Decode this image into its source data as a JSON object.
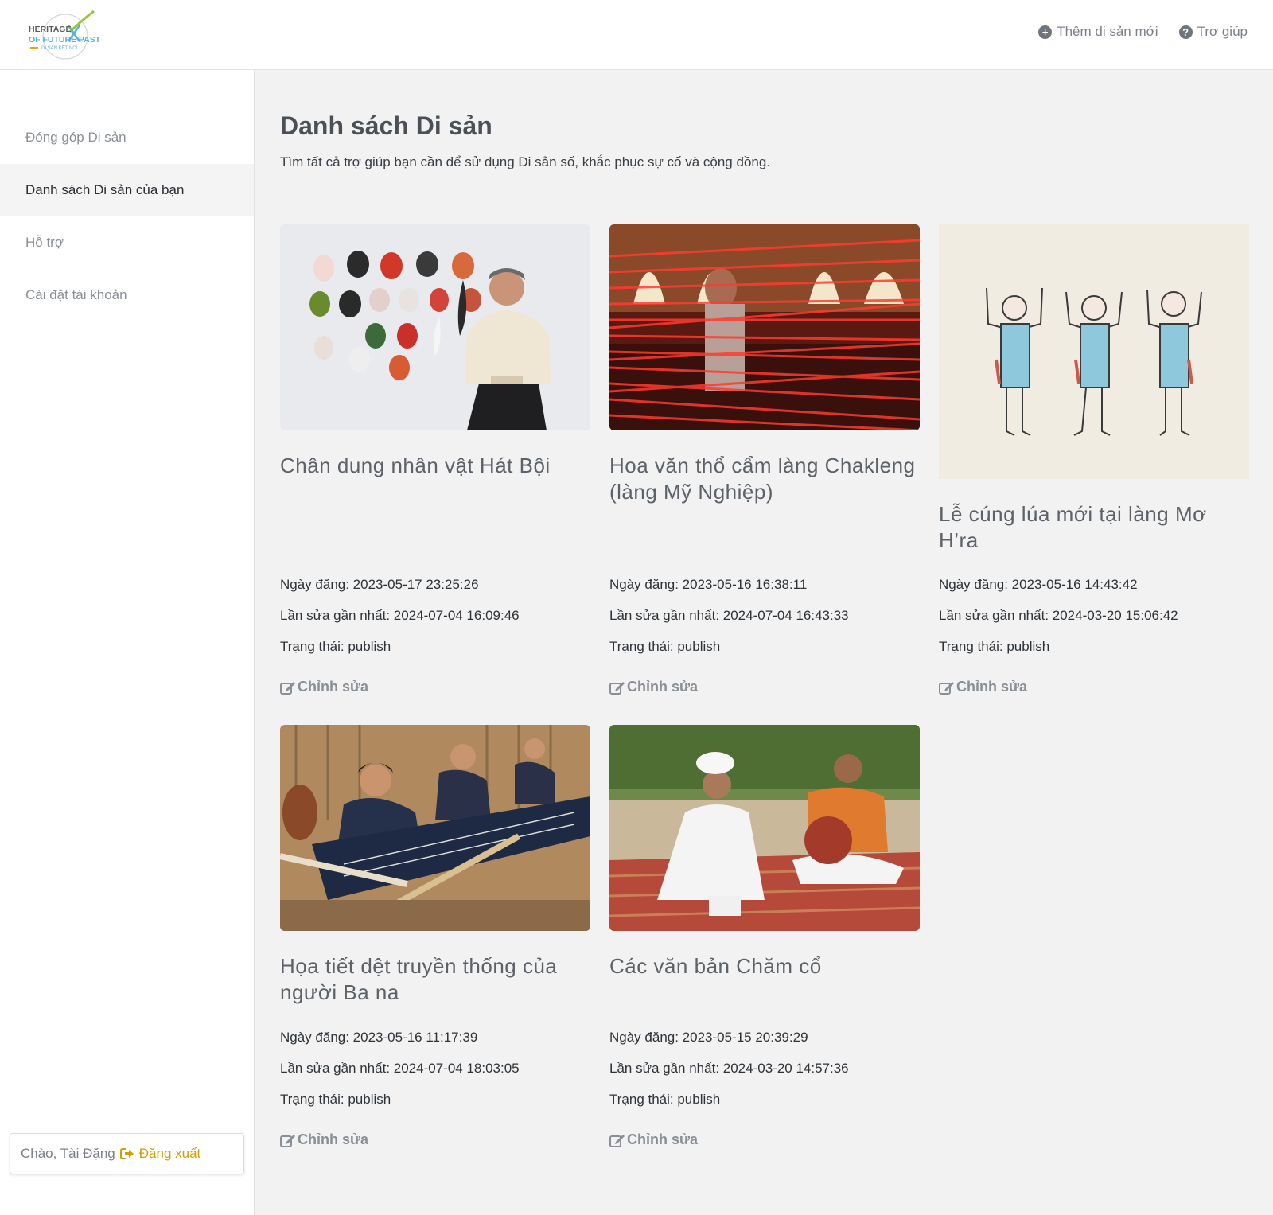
{
  "header": {
    "logo_text": "HERITAGE OF FUTURE PAST - DI SẢN KẾT NỐI",
    "add_label": "Thêm di sản mới",
    "help_label": "Trợ giúp",
    "add_icon": "plus-circle-icon",
    "help_icon": "question-circle-icon"
  },
  "sidebar": {
    "items": [
      {
        "label": "Đóng góp Di sản",
        "active": false
      },
      {
        "label": "Danh sách Di sản của bạn",
        "active": true
      },
      {
        "label": "Hỗ trợ",
        "active": false
      },
      {
        "label": "Cài đặt tài khoản",
        "active": false
      }
    ],
    "greeting": "Chào, Tài Đặng",
    "logout_label": "Đăng xuất",
    "logout_icon": "sign-out-icon"
  },
  "main": {
    "title": "Danh sách Di sản",
    "description": "Tìm tất cả trợ giúp bạn cần để sử dụng Di sản số, khắc phục sự cố và cộng đồng.",
    "edit_label": "Chỉnh sửa",
    "cards": [
      {
        "title": "Chân dung nhân vật Hát Bội",
        "posted": "Ngày đăng: 2023-05-17 23:25:26",
        "modified": "Lần sửa gần nhất: 2024-07-04 16:09:46",
        "status": "Trạng thái: publish",
        "image": "photo of elderly man seated beside wall of Hát Bội masks"
      },
      {
        "title": "Hoa văn thổ cẩm làng Chakleng (làng Mỹ Nghiệp)",
        "posted": "Ngày đăng: 2023-05-16 16:38:11",
        "modified": "Lần sửa gần nhất: 2024-07-04 16:43:33",
        "status": "Trạng thái: publish",
        "image": "woman behind red weaving threads"
      },
      {
        "title": "Lễ cúng lúa mới tại làng Mơ H’ra",
        "posted": "Ngày đăng: 2023-05-16 14:43:42",
        "modified": "Lần sửa gần nhất: 2024-03-20 15:06:42",
        "status": "Trạng thái: publish",
        "image": "drawing of three figures in blue dresses with raised arms"
      },
      {
        "title": "Họa tiết dệt truyền thống của người Ba na",
        "posted": "Ngày đăng: 2023-05-16 11:17:39",
        "modified": "Lần sửa gần nhất: 2024-07-04 18:03:05",
        "status": "Trạng thái: publish",
        "image": "women weaving on backstrap looms"
      },
      {
        "title": "Các văn bản Chăm cổ",
        "posted": "Ngày đăng: 2023-05-15 20:39:29",
        "modified": "Lần sửa gần nhất: 2024-03-20 14:57:36",
        "status": "Trạng thái: publish",
        "image": "two men seated on mat, one with drum"
      }
    ]
  }
}
